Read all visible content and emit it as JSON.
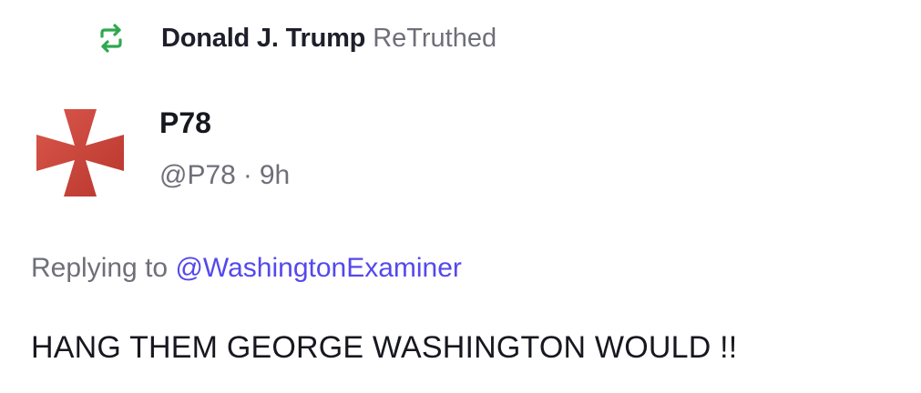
{
  "retruth": {
    "icon": "retruth-icon",
    "user_name": "Donald J. Trump",
    "label": "ReTruthed",
    "icon_color": "#2fa84f"
  },
  "author": {
    "avatar_icon": "red-cross-avatar",
    "avatar_color": "#c8443a",
    "display_name": "P78",
    "handle": "@P78",
    "separator": "·",
    "timestamp": "9h"
  },
  "reply": {
    "prefix": "Replying to",
    "mention": "@WashingtonExaminer",
    "mention_color": "#5448ee"
  },
  "post": {
    "text": "HANG THEM GEORGE WASHINGTON WOULD !!"
  }
}
